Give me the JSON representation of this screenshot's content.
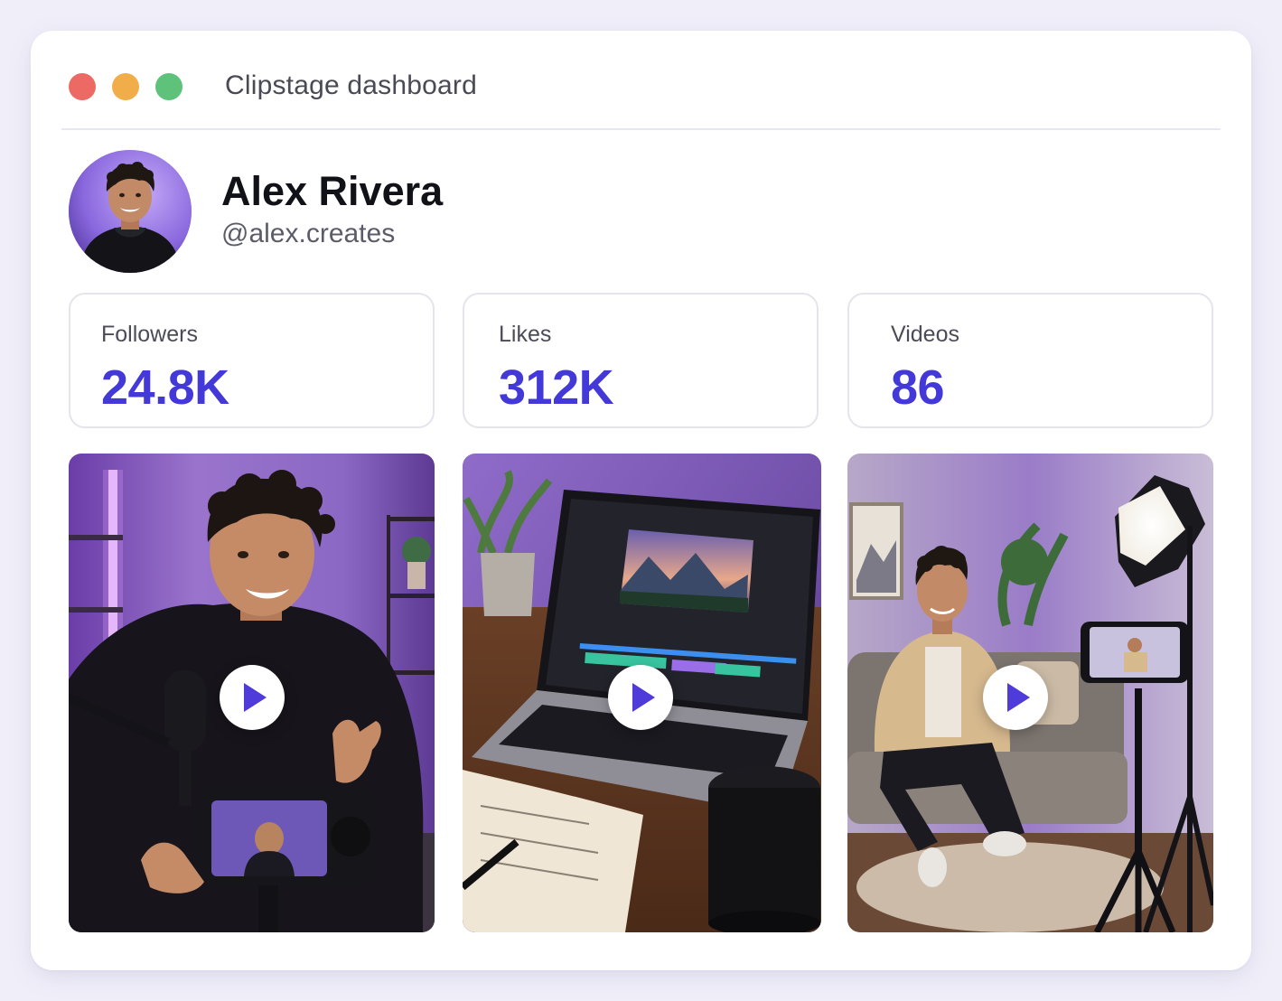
{
  "window": {
    "title": "Clipstage dashboard",
    "controls": {
      "close_color": "#ec6a63",
      "minimize_color": "#f1ad4a",
      "maximize_color": "#5fc27a"
    }
  },
  "profile": {
    "name": "Alex Rivera",
    "handle": "@alex.creates",
    "avatar_icon": "avatar-photo"
  },
  "stats": [
    {
      "label": "Followers",
      "value": "24.8K"
    },
    {
      "label": "Likes",
      "value": "312K"
    },
    {
      "label": "Videos",
      "value": "86"
    }
  ],
  "videos": [
    {
      "scene": "creator talking to camera with microphone",
      "icon": "play-icon"
    },
    {
      "scene": "laptop with video editing timeline",
      "icon": "play-icon"
    },
    {
      "scene": "creator on couch filmed by phone on tripod",
      "icon": "play-icon"
    }
  ],
  "colors": {
    "accent": "#4338d8",
    "play_glyph": "#4f3bd9",
    "border": "#e4e4ec"
  }
}
